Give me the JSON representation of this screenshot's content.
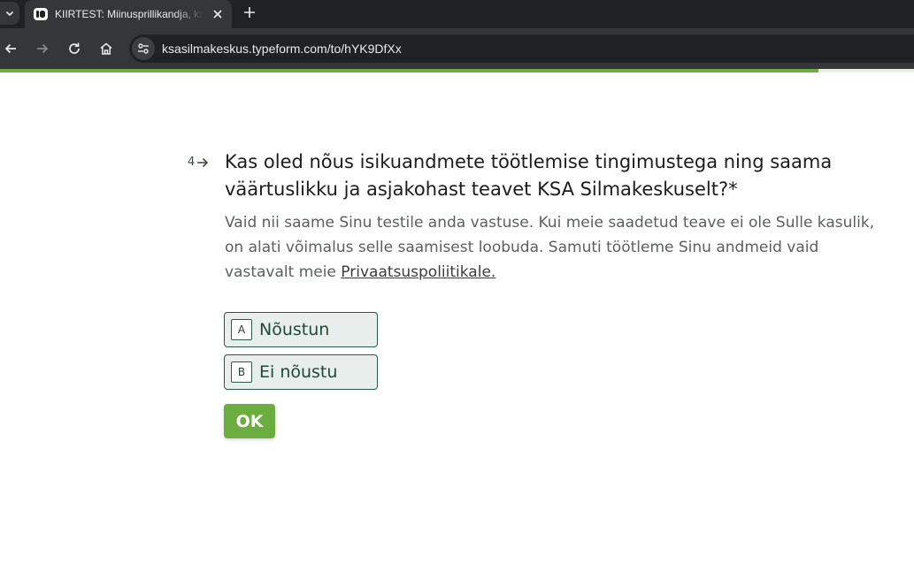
{
  "browser": {
    "tab": {
      "title": "KIIRTEST: Miinusprillikandja, kas",
      "favicon": "typeform-icon",
      "close": "close-icon"
    },
    "new_tab": "plus-icon",
    "url": "ksasilmakeskus.typeform.com/to/hYK9DfXx",
    "icons": [
      "chevron-down-icon",
      "back-arrow-icon",
      "forward-arrow-icon",
      "reload-icon",
      "home-icon",
      "site-settings-icon"
    ]
  },
  "progress": {
    "fraction": 0.895,
    "color": "#6bad3e"
  },
  "question": {
    "number": "4",
    "title": "Kas oled nõus isikuandmete töötlemise tingimustega ning saama väärtuslikku ja asjakohast teavet KSA Silmakeskuselt?*",
    "description": "Vaid nii saame Sinu testile anda vastuse. Kui meie saadetud teave ei ole Sulle kasulik, on alati võimalus selle saamisest loobuda. Samuti töötleme Sinu andmeid vaid vastavalt meie ",
    "link_text": "Privaatsuspoliitikale."
  },
  "choices": [
    {
      "key": "A",
      "label": "Nõustun"
    },
    {
      "key": "B",
      "label": "Ei nõustu"
    }
  ],
  "ok_label": "OK",
  "colors": {
    "accent": "#6bad3e",
    "choice_border": "#2b5b48",
    "choice_bg": "#e8eeeb",
    "chrome_dark": "#202124",
    "chrome_toolbar": "#35363a"
  }
}
